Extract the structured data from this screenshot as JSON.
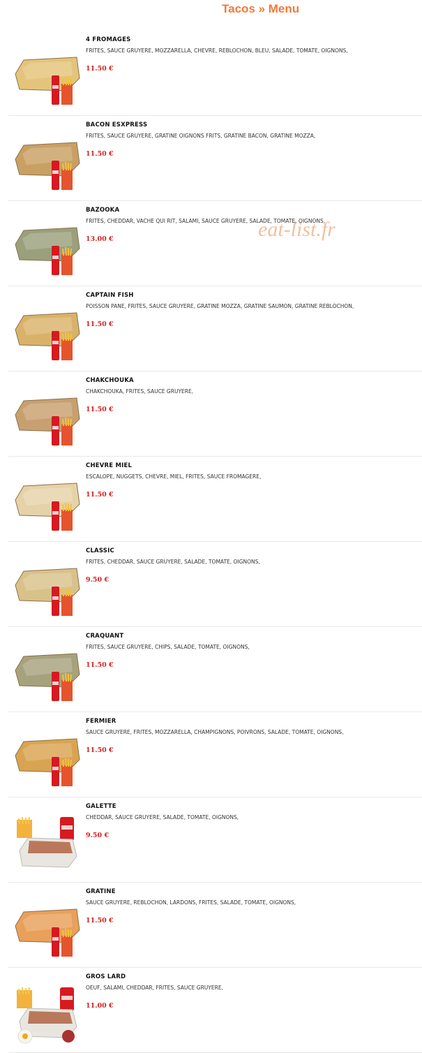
{
  "header": {
    "title": "Tacos » Menu"
  },
  "watermark": "eat-list.fr",
  "colors": {
    "title": "#f07a3a",
    "price": "#d61f1f",
    "watermark": "#f3b48e"
  },
  "items": [
    {
      "name": "4 FROMAGES",
      "description": "FRITES, SAUCE GRUYERE, MOZZARELLA, CHEVRE, REBLOCHON, BLEU, SALADE, TOMATE, OIGNONS,",
      "price": "11.50 €"
    },
    {
      "name": "BACON ESXPRESS",
      "description": "FRITES, SAUCE GRUYERE, GRATINE OIGNONS FRITS, GRATINE BACON, GRATINE MOZZA,",
      "price": "11.50 €"
    },
    {
      "name": "BAZOOKA",
      "description": "FRITES, CHEDDAR, VACHE QUI RIT, SALAMI, SAUCE GRUYERE, SALADE, TOMATE, OIGNONS,",
      "price": "13.00 €"
    },
    {
      "name": "CAPTAIN FISH",
      "description": "POISSON PANE, FRITES, SAUCE GRUYERE, GRATINE MOZZA, GRATINE SAUMON, GRATINE REBLOCHON,",
      "price": "11.50 €"
    },
    {
      "name": "CHAKCHOUKA",
      "description": "CHAKCHOUKA, FRITES, SAUCE GRUYERE,",
      "price": "11.50 €"
    },
    {
      "name": "CHEVRE MIEL",
      "description": "ESCALOPE, NUGGETS, CHEVRE, MIEL, FRITES, SAUCE FROMAGERE,",
      "price": "11.50 €"
    },
    {
      "name": "CLASSIC",
      "description": "FRITES, CHEDDAR, SAUCE GRUYERE, SALADE, TOMATE, OIGNONS,",
      "price": "9.50 €"
    },
    {
      "name": "CRAQUANT",
      "description": "FRITES, SAUCE GRUYERE, CHIPS, SALADE, TOMATE, OIGNONS,",
      "price": "11.50 €"
    },
    {
      "name": "FERMIER",
      "description": "SAUCE GRUYERE, FRITES, MOZZARELLA, CHAMPIGNONS, POIVRONS, SALADE, TOMATE, OIGNONS,",
      "price": "11.50 €"
    },
    {
      "name": "GALETTE",
      "description": "CHEDDAR, SAUCE GRUYERE, SALADE, TOMATE, OIGNONS,",
      "price": "9.50 €"
    },
    {
      "name": "GRATINE",
      "description": "SAUCE GRUYERE, REBLOCHON, LARDONS, FRITES, SALADE, TOMATE, OIGNONS,",
      "price": "11.50 €"
    },
    {
      "name": "GROS LARD",
      "description": "OEUF, SALAMI, CHEDDAR, FRITES, SAUCE GRUYERE,",
      "price": "11.00 €"
    }
  ]
}
